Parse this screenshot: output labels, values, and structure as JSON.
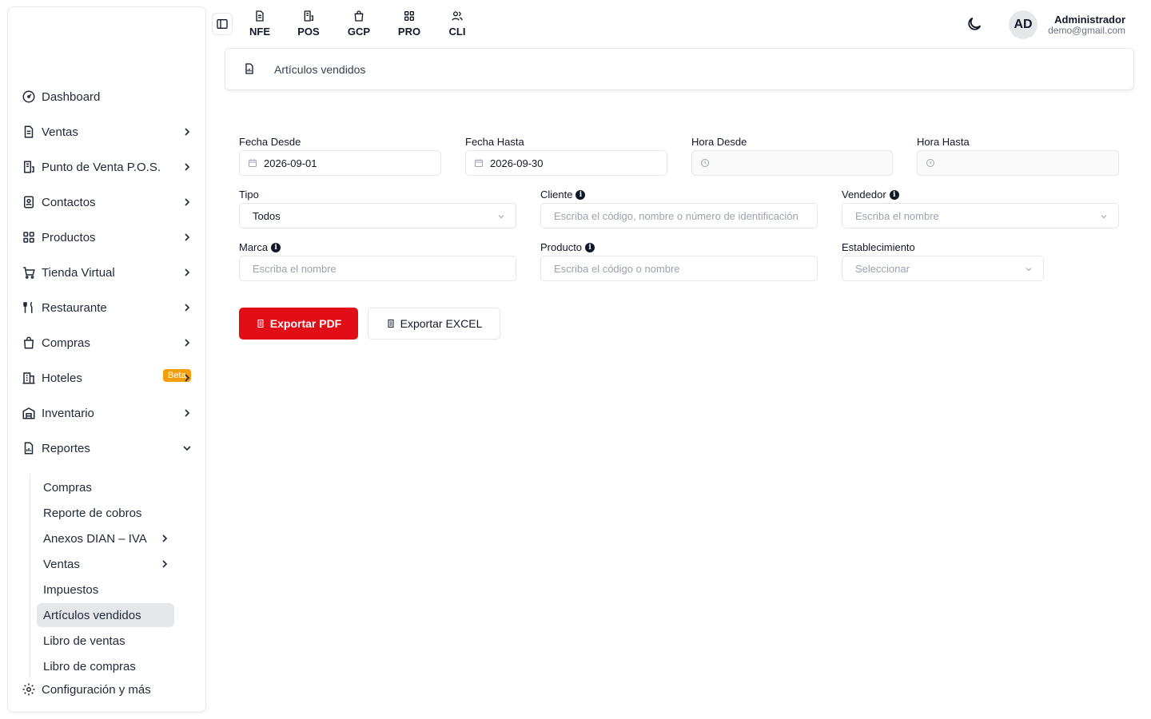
{
  "sidebar": {
    "items": [
      {
        "label": "Dashboard",
        "icon": "dashboard-icon"
      },
      {
        "label": "Ventas",
        "icon": "document-icon"
      },
      {
        "label": "Punto de Venta P.O.S.",
        "icon": "pos-icon"
      },
      {
        "label": "Contactos",
        "icon": "contacts-icon"
      },
      {
        "label": "Productos",
        "icon": "grid-icon"
      },
      {
        "label": "Tienda Virtual",
        "icon": "cart-icon"
      },
      {
        "label": "Restaurante",
        "icon": "utensils-icon"
      },
      {
        "label": "Compras",
        "icon": "bag-icon"
      },
      {
        "label": "Hoteles",
        "icon": "building-icon",
        "badge": "Beta"
      },
      {
        "label": "Inventario",
        "icon": "warehouse-icon"
      },
      {
        "label": "Reportes",
        "icon": "report-icon"
      }
    ],
    "reports_sub": [
      {
        "label": "Compras"
      },
      {
        "label": "Reporte de cobros"
      },
      {
        "label": "Anexos DIAN – IVA"
      },
      {
        "label": "Ventas"
      },
      {
        "label": "Impuestos"
      },
      {
        "label": "Artículos vendidos"
      },
      {
        "label": "Libro de ventas"
      },
      {
        "label": "Libro de compras"
      }
    ],
    "settings": {
      "label": "Configuración y más",
      "icon": "gear-icon"
    }
  },
  "topbar": {
    "modules": [
      "NFE",
      "POS",
      "GCP",
      "PRO",
      "CLI"
    ],
    "avatar": "AD",
    "user_name": "Administrador",
    "user_email": "demo@gmail.com"
  },
  "breadcrumb": {
    "title": "Artículos vendidos"
  },
  "form": {
    "fecha_desde": {
      "label": "Fecha Desde",
      "value": "2026-09-01"
    },
    "fecha_hasta": {
      "label": "Fecha Hasta",
      "value": "2026-09-30"
    },
    "hora_desde": {
      "label": "Hora Desde"
    },
    "hora_hasta": {
      "label": "Hora Hasta"
    },
    "tipo": {
      "label": "Tipo",
      "value": "Todos"
    },
    "cliente": {
      "label": "Cliente",
      "placeholder": "Escriba el código, nombre o número de identificación"
    },
    "vendedor": {
      "label": "Vendedor",
      "placeholder": "Escriba el nombre"
    },
    "marca": {
      "label": "Marca",
      "placeholder": "Escriba el nombre"
    },
    "producto": {
      "label": "Producto",
      "placeholder": "Escriba el código o nombre"
    },
    "establecimiento": {
      "label": "Establecimiento",
      "placeholder": "Seleccionar"
    }
  },
  "actions": {
    "pdf": "Exportar PDF",
    "excel": "Exportar EXCEL"
  },
  "colors": {
    "accent": "#e10e17",
    "badge": "#f59e0b",
    "active_bg": "#e5e7eb"
  }
}
